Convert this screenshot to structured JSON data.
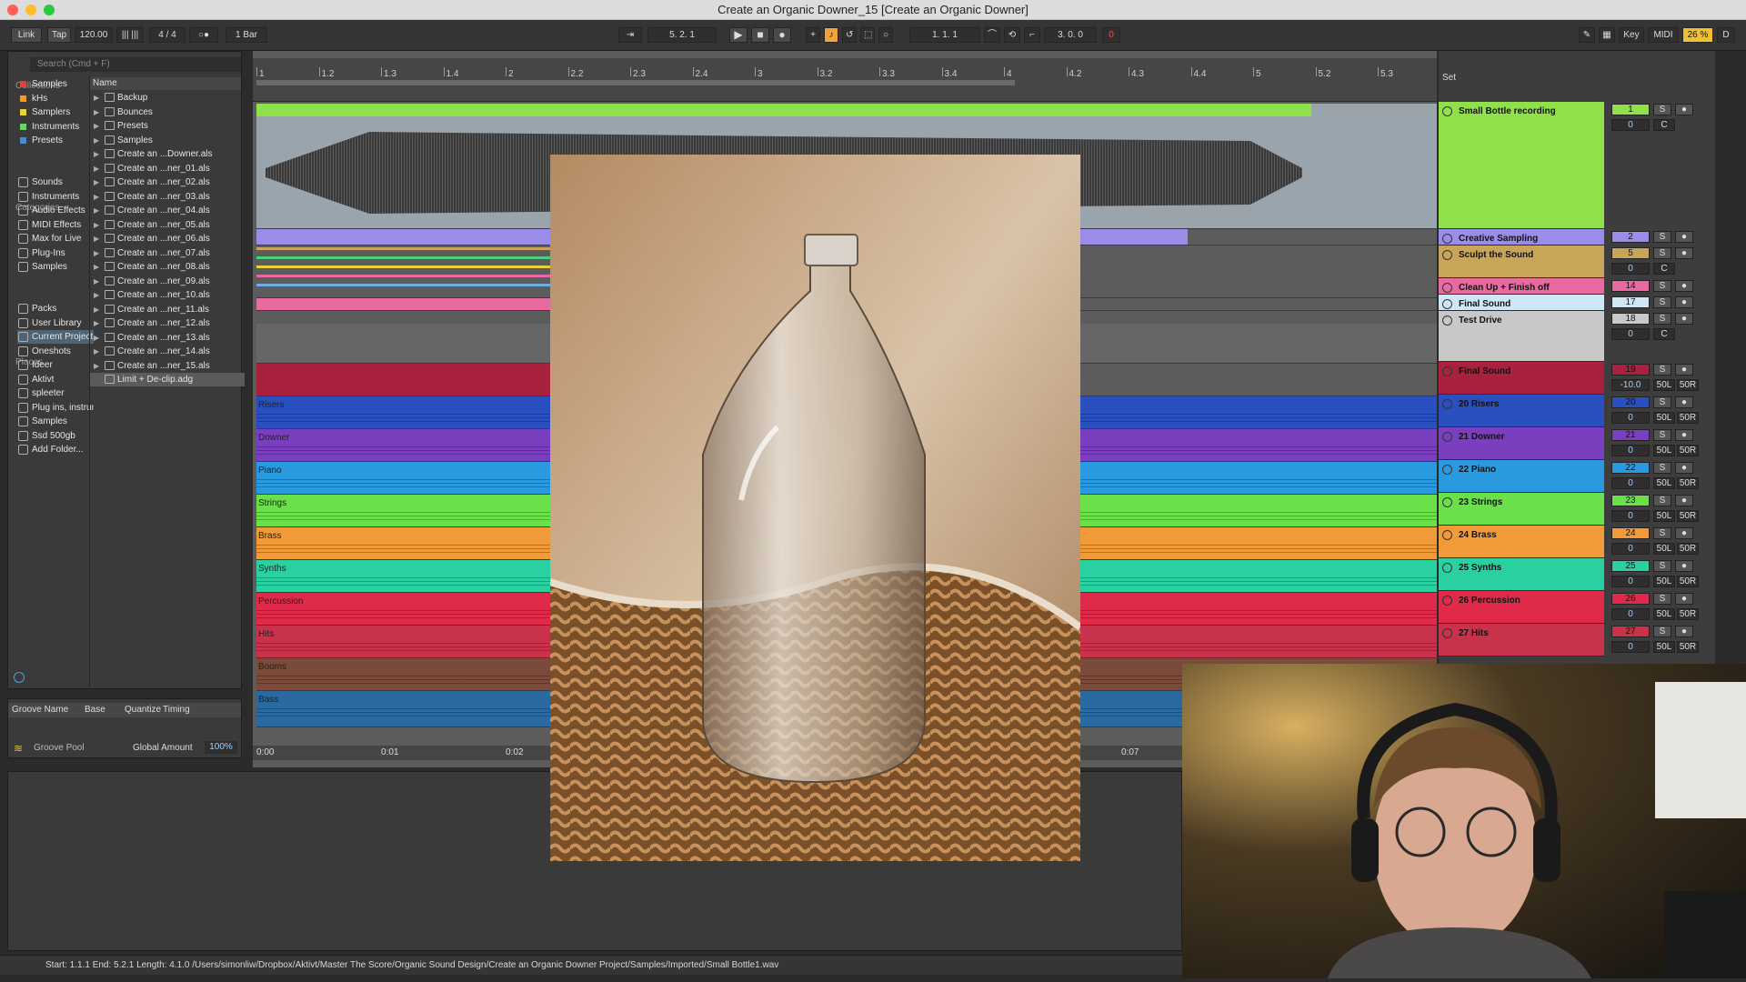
{
  "window_title": "Create an Organic Downer_15  [Create an Organic Downer]",
  "transport": {
    "link": "Link",
    "tap": "Tap",
    "tempo": "120.00",
    "time_sig": "4 / 4",
    "quantize": "1 Bar",
    "position": "5.  2.  1",
    "loop_start": "1.  1.  1",
    "loop_length": "3.  0.  0",
    "overload": "0",
    "key": "Key",
    "midi": "MIDI",
    "cpu": "26 %",
    "d": "D"
  },
  "browser": {
    "search_placeholder": "Search (Cmd + F)",
    "collections_label": "Collections",
    "collections": [
      {
        "label": "Samples",
        "color": "#e0413a"
      },
      {
        "label": "kHs",
        "color": "#f09a2a"
      },
      {
        "label": "Samplers",
        "color": "#e8d23a"
      },
      {
        "label": "Instruments",
        "color": "#6cd26a"
      },
      {
        "label": "Presets",
        "color": "#3a8fe0"
      }
    ],
    "categories_label": "Categories",
    "categories": [
      {
        "label": "Sounds",
        "icon": "sounds-icon"
      },
      {
        "label": "Instruments",
        "icon": "instruments-icon"
      },
      {
        "label": "Audio Effects",
        "icon": "audio-effects-icon"
      },
      {
        "label": "MIDI Effects",
        "icon": "midi-effects-icon"
      },
      {
        "label": "Max for Live",
        "icon": "max-for-live-icon"
      },
      {
        "label": "Plug-Ins",
        "icon": "plugins-icon"
      },
      {
        "label": "Samples",
        "icon": "samples-icon"
      }
    ],
    "places_label": "Places",
    "places": [
      {
        "label": "Packs",
        "selected": false
      },
      {
        "label": "User Library",
        "selected": false
      },
      {
        "label": "Current Project",
        "selected": true
      },
      {
        "label": "Oneshots",
        "selected": false
      },
      {
        "label": "Ideer",
        "selected": false
      },
      {
        "label": "Aktivt",
        "selected": false
      },
      {
        "label": "spleeter",
        "selected": false
      },
      {
        "label": "Plug ins, instruments",
        "selected": false
      },
      {
        "label": "Samples",
        "selected": false
      },
      {
        "label": "Ssd 500gb",
        "selected": false
      },
      {
        "label": "Add Folder...",
        "selected": false
      }
    ],
    "name_header": "Name",
    "files": [
      {
        "label": "Backup",
        "type": "folder",
        "selected": false
      },
      {
        "label": "Bounces",
        "type": "folder",
        "selected": false
      },
      {
        "label": "Presets",
        "type": "folder",
        "selected": false
      },
      {
        "label": "Samples",
        "type": "folder",
        "selected": false
      },
      {
        "label": "Create an ...Downer.als",
        "type": "file",
        "selected": false
      },
      {
        "label": "Create an ...ner_01.als",
        "type": "file",
        "selected": false
      },
      {
        "label": "Create an ...ner_02.als",
        "type": "file",
        "selected": false
      },
      {
        "label": "Create an ...ner_03.als",
        "type": "file",
        "selected": false
      },
      {
        "label": "Create an ...ner_04.als",
        "type": "file",
        "selected": false
      },
      {
        "label": "Create an ...ner_05.als",
        "type": "file",
        "selected": false
      },
      {
        "label": "Create an ...ner_06.als",
        "type": "file",
        "selected": false
      },
      {
        "label": "Create an ...ner_07.als",
        "type": "file",
        "selected": false
      },
      {
        "label": "Create an ...ner_08.als",
        "type": "file",
        "selected": false
      },
      {
        "label": "Create an ...ner_09.als",
        "type": "file",
        "selected": false
      },
      {
        "label": "Create an ...ner_10.als",
        "type": "file",
        "selected": false
      },
      {
        "label": "Create an ...ner_11.als",
        "type": "file",
        "selected": false
      },
      {
        "label": "Create an ...ner_12.als",
        "type": "file",
        "selected": false
      },
      {
        "label": "Create an ...ner_13.als",
        "type": "file",
        "selected": false
      },
      {
        "label": "Create an ...ner_14.als",
        "type": "file",
        "selected": false
      },
      {
        "label": "Create an ...ner_15.als",
        "type": "file",
        "selected": false
      },
      {
        "label": "Limit + De-clip.adg",
        "type": "preset",
        "selected": true
      }
    ]
  },
  "groove": {
    "headers": [
      "Groove Name",
      "Base",
      "Quantize",
      "Timing"
    ],
    "pool_label": "Groove Pool",
    "global_amount_label": "Global Amount",
    "global_amount": "100%"
  },
  "ruler": {
    "bars": [
      "1",
      "1.2",
      "1.3",
      "1.4",
      "2",
      "2.2",
      "2.3",
      "2.4",
      "3",
      "3.2",
      "3.3",
      "3.4",
      "4",
      "4.2",
      "4.3",
      "4.4",
      "5",
      "5.2",
      "5.3"
    ],
    "times": [
      "0:00",
      "0:01",
      "0:02",
      "0:07"
    ],
    "set_label": "Set"
  },
  "lanes": [
    {
      "name": "",
      "color": "#8fe04a",
      "kind": "audio"
    },
    {
      "name": "",
      "color": "#9a8ce8",
      "kind": "clip"
    },
    {
      "name": "",
      "color": "#c9a55a",
      "kind": "strips"
    },
    {
      "name": "",
      "color": "#e86aa0",
      "kind": "clip"
    },
    {
      "name": "",
      "color": "#c8c8c8",
      "kind": "empty"
    },
    {
      "name": "",
      "color": "#a8223e",
      "kind": "clip"
    },
    {
      "name": "Risers",
      "color": "#2a4fbf",
      "kind": "group"
    },
    {
      "name": "Downer",
      "color": "#7a3fbf",
      "kind": "group"
    },
    {
      "name": "Piano",
      "color": "#2a9ae0",
      "kind": "group"
    },
    {
      "name": "Strings",
      "color": "#6ae04a",
      "kind": "group"
    },
    {
      "name": "Brass",
      "color": "#f09a3a",
      "kind": "group"
    },
    {
      "name": "Synths",
      "color": "#2ad0a0",
      "kind": "group"
    },
    {
      "name": "Percussion",
      "color": "#e02a4a",
      "kind": "group"
    },
    {
      "name": "Hits",
      "color": "#c8324a",
      "kind": "group"
    },
    {
      "name": "Booms",
      "color": "#7a4a3a",
      "kind": "group"
    },
    {
      "name": "Bass",
      "color": "#2a6aa0",
      "kind": "group"
    }
  ],
  "tracks": [
    {
      "name": "Small Bottle recording",
      "color": "#8fe04a",
      "num": "1",
      "vol": "0",
      "pan": "C"
    },
    {
      "name": "Creative Sampling",
      "color": "#9a8ce8",
      "num": "2",
      "vol": "",
      "pan": ""
    },
    {
      "name": "Sculpt the Sound",
      "color": "#c9a55a",
      "num": "5",
      "vol": "0",
      "pan": "C"
    },
    {
      "name": "Clean Up + Finish off",
      "color": "#e86aa0",
      "num": "14",
      "vol": "",
      "pan": ""
    },
    {
      "name": "Final Sound",
      "color": "#cfe8f8",
      "num": "17",
      "vol": "",
      "pan": ""
    },
    {
      "name": "Test Drive",
      "color": "#c8c8c8",
      "num": "18",
      "vol": "0",
      "pan": "C"
    },
    {
      "name": "Final Sound",
      "color": "#a8223e",
      "num": "19",
      "vol": "-10.0",
      "pan": "50L"
    },
    {
      "name": "20 Risers",
      "color": "#2a4fbf",
      "num": "20",
      "vol": "0",
      "pan": "50L"
    },
    {
      "name": "21 Downer",
      "color": "#7a3fbf",
      "num": "21",
      "vol": "0",
      "pan": "50L"
    },
    {
      "name": "22 Piano",
      "color": "#2a9ae0",
      "num": "22",
      "vol": "0",
      "pan": "50L"
    },
    {
      "name": "23 Strings",
      "color": "#6ae04a",
      "num": "23",
      "vol": "0",
      "pan": "50L"
    },
    {
      "name": "24 Brass",
      "color": "#f09a3a",
      "num": "24",
      "vol": "0",
      "pan": "50L"
    },
    {
      "name": "25 Synths",
      "color": "#2ad0a0",
      "num": "25",
      "vol": "0",
      "pan": "50L"
    },
    {
      "name": "26 Percussion",
      "color": "#e02a4a",
      "num": "26",
      "vol": "0",
      "pan": "50L"
    },
    {
      "name": "27 Hits",
      "color": "#c8324a",
      "num": "27",
      "vol": "0",
      "pan": "50L"
    }
  ],
  "mixer_labels": {
    "solo": "S",
    "right_pan": "50R"
  },
  "status_text": "Start: 1.1.1  End: 5.2.1  Length: 4.1.0  /Users/simonliw/Dropbox/Aktivt/Master The Score/Organic Sound Design/Create an Organic Downer Project/Samples/Imported/Small Bottle1.wav"
}
